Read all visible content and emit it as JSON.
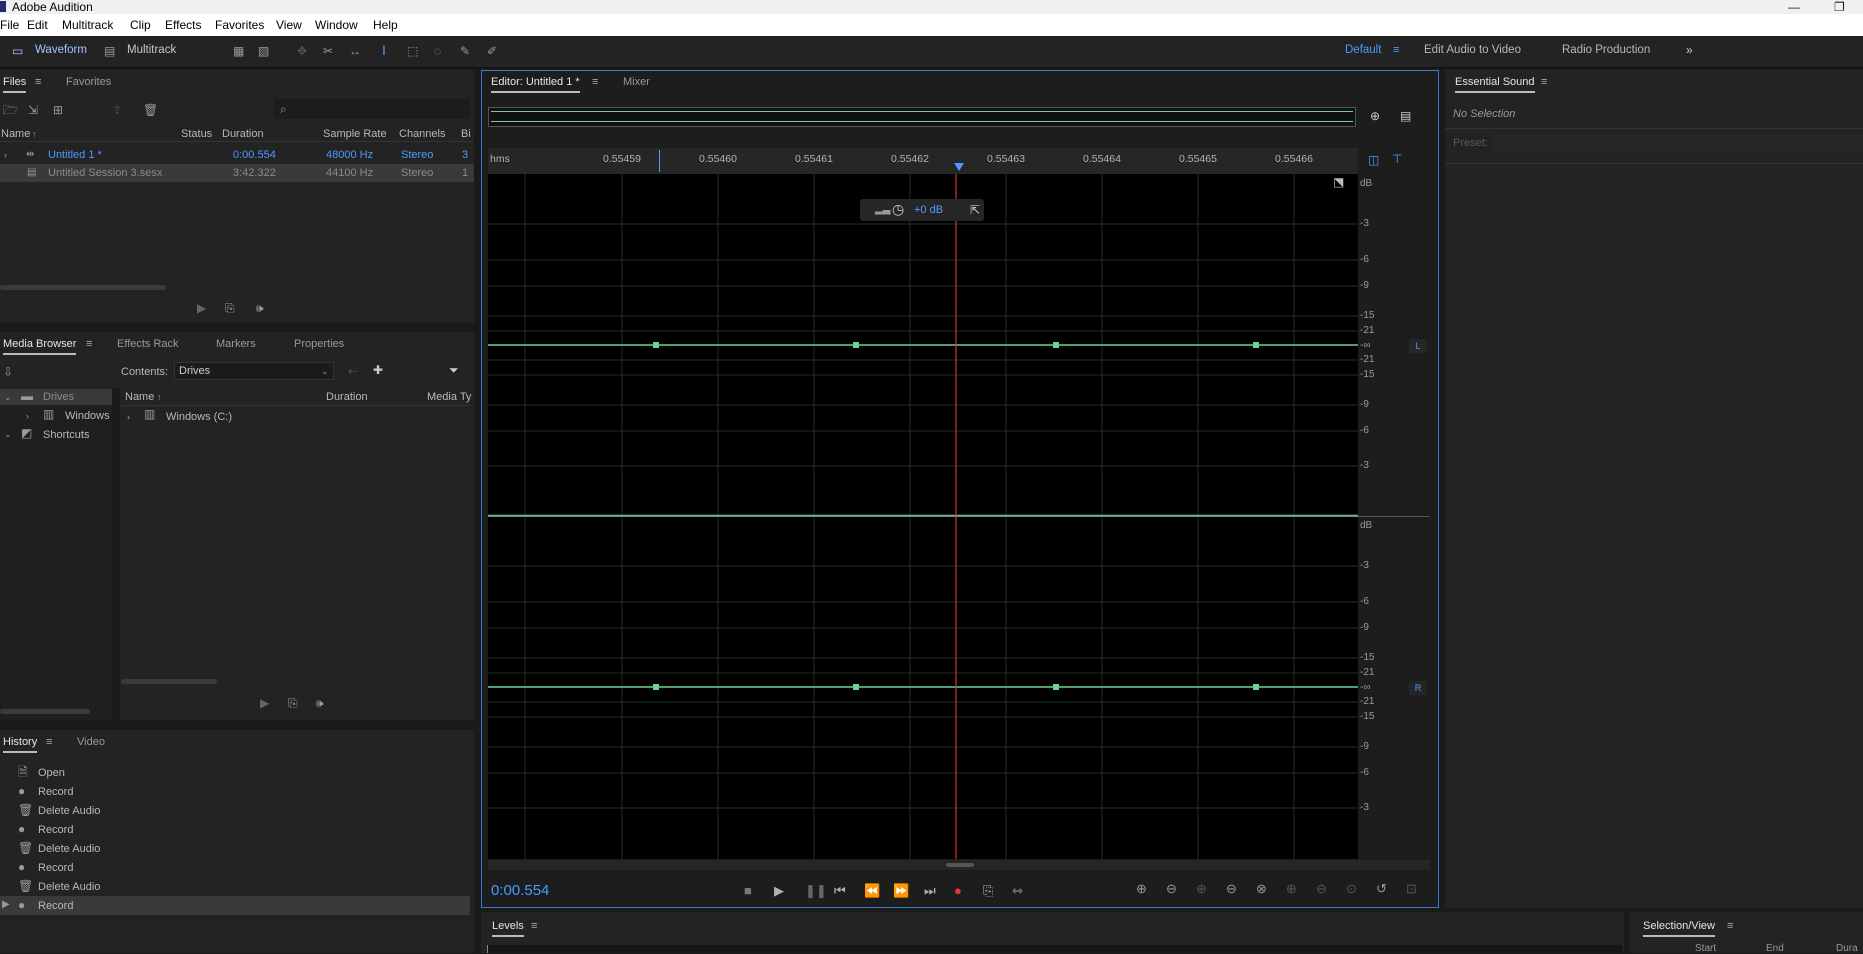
{
  "app": {
    "title": "Adobe Audition"
  },
  "menu": [
    "File",
    "Edit",
    "Multitrack",
    "Clip",
    "Effects",
    "Favorites",
    "View",
    "Window",
    "Help"
  ],
  "toolbar": {
    "waveform": "Waveform",
    "multitrack": "Multitrack",
    "ws_default": "Default",
    "ws_edit_av": "Edit Audio to Video",
    "ws_radio": "Radio Production"
  },
  "files": {
    "tabs": [
      "Files",
      "Favorites"
    ],
    "columns": [
      "Name",
      "Status",
      "Duration",
      "Sample Rate",
      "Channels",
      "Bi"
    ],
    "rows": [
      {
        "name": "Untitled 1 *",
        "status": "",
        "duration": "0:00.554",
        "rate": "48000 Hz",
        "channels": "Stereo",
        "bits": "3"
      },
      {
        "name": "Untitled Session 3.sesx",
        "status": "",
        "duration": "3:42.322",
        "rate": "44100 Hz",
        "channels": "Stereo",
        "bits": "1"
      }
    ]
  },
  "media": {
    "tabs": [
      "Media Browser",
      "Effects Rack",
      "Markers",
      "Properties"
    ],
    "contents_label": "Contents:",
    "contents_value": "Drives",
    "tree": [
      "Drives",
      "Windows",
      "Shortcuts"
    ],
    "columns": [
      "Name",
      "Duration",
      "Media Ty"
    ],
    "items": [
      "Windows (C:)"
    ]
  },
  "history": {
    "tabs": [
      "History",
      "Video"
    ],
    "items": [
      "Open",
      "Record",
      "Delete Audio",
      "Record",
      "Delete Audio",
      "Record",
      "Delete Audio",
      "Record"
    ]
  },
  "editor": {
    "tabs": [
      "Editor: Untitled 1 *",
      "Mixer"
    ],
    "ruler_unit": "hms",
    "ruler_labels": [
      "0.55459",
      "0.55460",
      "0.55461",
      "0.55462",
      "0.55463",
      "0.55464",
      "0.55465",
      "0.55466"
    ],
    "gain_hud": "+0 dB",
    "db_labels": [
      "dB",
      "-3",
      "-6",
      "-9",
      "-15",
      "-21",
      "-∞",
      "-21",
      "-15",
      "-9",
      "-6",
      "-3"
    ],
    "ch_left": "L",
    "ch_right": "R",
    "time": "0:00.554",
    "playhead_fraction": 0.5385
  },
  "essential": {
    "title": "Essential Sound",
    "no_selection": "No Selection",
    "preset_label": "Preset:"
  },
  "levels": {
    "title": "Levels"
  },
  "selview": {
    "title": "Selection/View",
    "cols": [
      "Start",
      "End",
      "Dura"
    ]
  },
  "colors": {
    "accent": "#4a9cff",
    "waveform": "#6fd09a",
    "playhead": "#d9342b",
    "grid": "#1d3322"
  }
}
